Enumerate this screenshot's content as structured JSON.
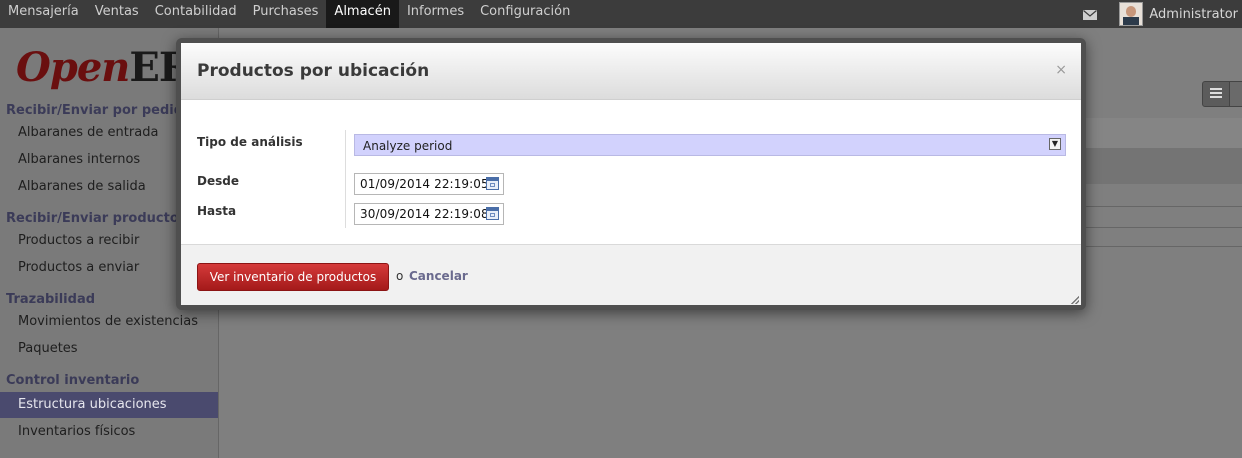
{
  "topbar": {
    "menu": [
      {
        "label": "Mensajería",
        "active": false
      },
      {
        "label": "Ventas",
        "active": false
      },
      {
        "label": "Contabilidad",
        "active": false
      },
      {
        "label": "Purchases",
        "active": false
      },
      {
        "label": "Almacén",
        "active": true
      },
      {
        "label": "Informes",
        "active": false
      },
      {
        "label": "Configuración",
        "active": false
      }
    ],
    "user_name": "Administrator",
    "icons": {
      "mail": "envelope-icon",
      "avatar": "user-avatar"
    }
  },
  "sidebar": {
    "logo": {
      "open": "Open",
      "erp": "ERP"
    },
    "sections": [
      {
        "title": "Recibir/Enviar por pedidos",
        "items": [
          "Albaranes de entrada",
          "Albaranes internos",
          "Albaranes de salida"
        ]
      },
      {
        "title": "Recibir/Enviar productos",
        "items": [
          "Productos a recibir",
          "Productos a enviar"
        ]
      },
      {
        "title": "Trazabilidad",
        "items": [
          "Movimientos de existencias",
          "Paquetes"
        ]
      },
      {
        "title": "Control inventario",
        "items": [
          "Estructura ubicaciones",
          "Inventarios físicos"
        ]
      }
    ],
    "active_item": "Estructura ubicaciones"
  },
  "dialog": {
    "title": "Productos por ubicación",
    "close_label": "×",
    "fields": {
      "analysis_type": {
        "label": "Tipo de análisis",
        "value": "Analyze period"
      },
      "from": {
        "label": "Desde",
        "value": "01/09/2014 22:19:05"
      },
      "to": {
        "label": "Hasta",
        "value": "30/09/2014 22:19:08"
      }
    },
    "footer": {
      "primary_label": "Ver inventario de productos",
      "or_text": "o",
      "cancel_label": "Cancelar"
    }
  },
  "colors": {
    "topbar_bg": "#3c3c3c",
    "primary_button": "#c02828",
    "select_bg": "#d2d2fd",
    "section_title": "#3b3b58"
  }
}
